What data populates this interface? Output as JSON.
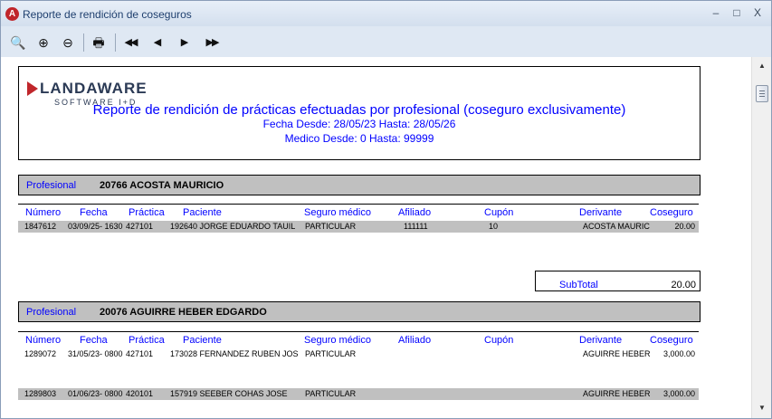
{
  "window": {
    "title": "Reporte de rendición de coseguros",
    "app_icon_letter": "A",
    "controls": {
      "minimize": "–",
      "maximize": "□",
      "close": "X"
    }
  },
  "toolbar": {
    "buttons": [
      {
        "name": "preview-icon",
        "glyph": "🔍"
      },
      {
        "name": "zoom-in-icon",
        "glyph": "⊕"
      },
      {
        "name": "zoom-out-icon",
        "glyph": "⊖"
      },
      {
        "name": "print-icon",
        "glyph": "🖶"
      },
      {
        "name": "first-page-icon",
        "glyph": "◀◀"
      },
      {
        "name": "prev-page-icon",
        "glyph": "◀"
      },
      {
        "name": "next-page-icon",
        "glyph": "▶"
      },
      {
        "name": "last-page-icon",
        "glyph": "▶▶"
      }
    ]
  },
  "report": {
    "logo": {
      "name": "LANDAWARE",
      "sub": "SOFTWARE I+D"
    },
    "title": "Reporte de rendición de prácticas efectuadas por profesional (coseguro exclusivamente)",
    "date_range": "Fecha Desde: 28/05/23 Hasta: 28/05/26",
    "medico_range": "Medico Desde: 0 Hasta: 99999",
    "profesional_label": "Profesional",
    "columns": [
      "Número",
      "Fecha",
      "Práctica",
      "Paciente",
      "Seguro médico",
      "Afiliado",
      "Cupón",
      "Derivante",
      "Coseguro"
    ],
    "subtotal_label": "SubTotal",
    "sections": [
      {
        "profesional": "20766 ACOSTA MAURICIO",
        "rows": [
          {
            "numero": "1847612",
            "fecha": "03/09/25- 1630",
            "practica": "427101",
            "paciente": "192640  JORGE EDUARDO TAUIL",
            "seguro": "PARTICULAR",
            "afiliado": "111111",
            "cupon": "10",
            "derivante": "ACOSTA MAURIC",
            "coseguro": "20.00"
          }
        ],
        "subtotal": "20.00"
      },
      {
        "profesional": "20076 AGUIRRE HEBER EDGARDO",
        "rows": [
          {
            "numero": "1289072",
            "fecha": "31/05/23- 0800",
            "practica": "427101",
            "paciente": "173028  FERNANDEZ RUBEN JOS",
            "seguro": "PARTICULAR",
            "afiliado": "",
            "cupon": "",
            "derivante": "AGUIRRE HEBER",
            "coseguro": "3,000.00"
          },
          {
            "numero": "1289803",
            "fecha": "01/06/23- 0800",
            "practica": "420101",
            "paciente": "157919  SEEBER COHAS JOSE",
            "seguro": "PARTICULAR",
            "afiliado": "",
            "cupon": "",
            "derivante": "AGUIRRE HEBER",
            "coseguro": "3,000.00"
          }
        ]
      }
    ]
  }
}
